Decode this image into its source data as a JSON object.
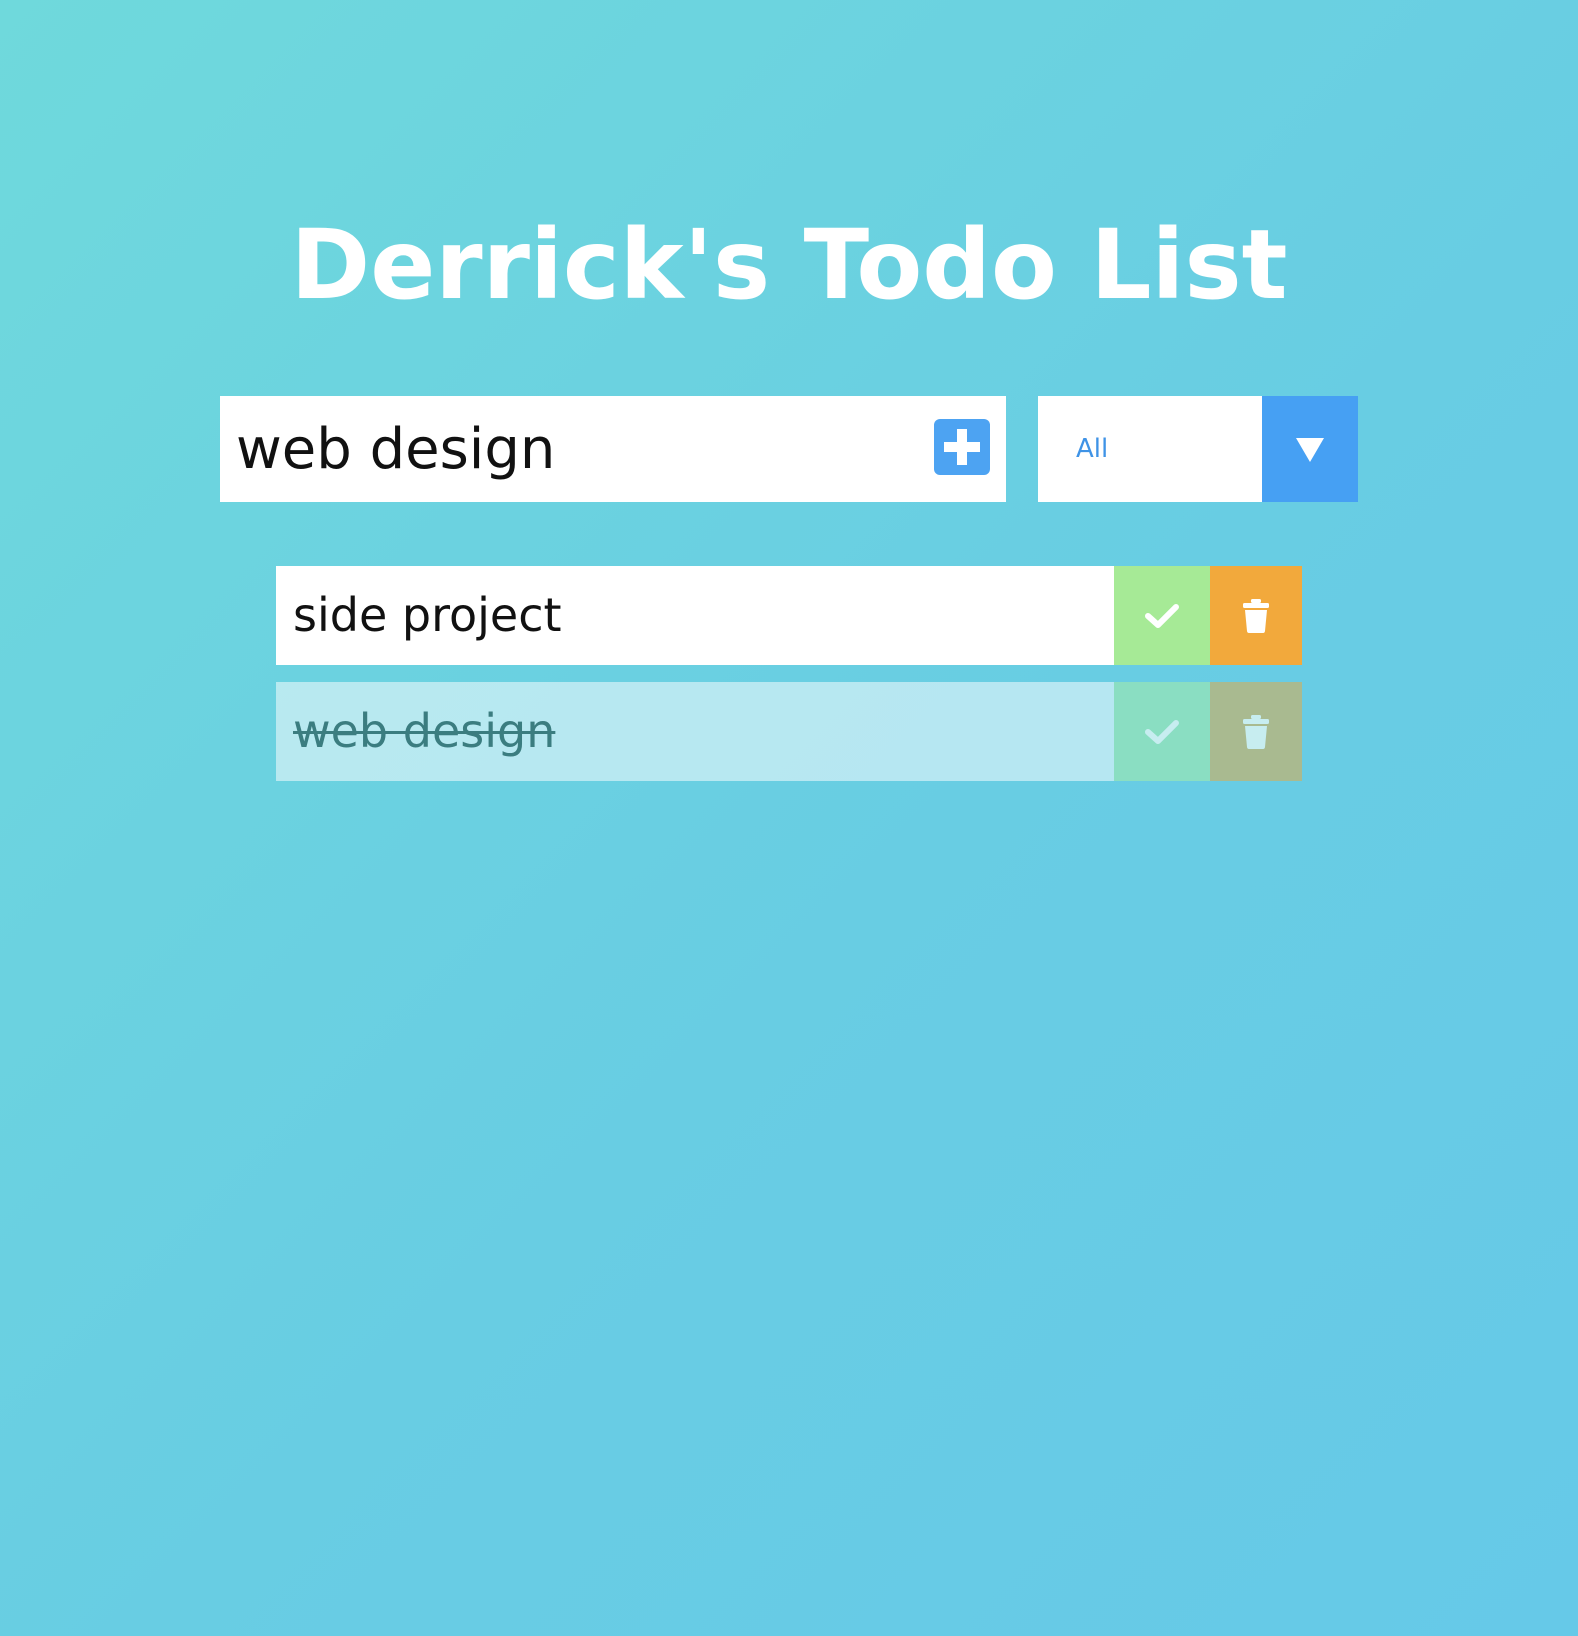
{
  "app": {
    "title": "Derrick's Todo List"
  },
  "form": {
    "input_value": "web design",
    "add_icon": "plus-square-icon",
    "filter": {
      "selected": "All",
      "arrow_icon": "triangle-down-icon"
    }
  },
  "todos": [
    {
      "text": "side project",
      "completed": false
    },
    {
      "text": "web design",
      "completed": true
    }
  ],
  "colors": {
    "accent": "#46a0f3",
    "check": "#a6ea96",
    "trash": "#f2a93c",
    "background_start": "#6fd9dc",
    "background_end": "#66c9e8"
  }
}
